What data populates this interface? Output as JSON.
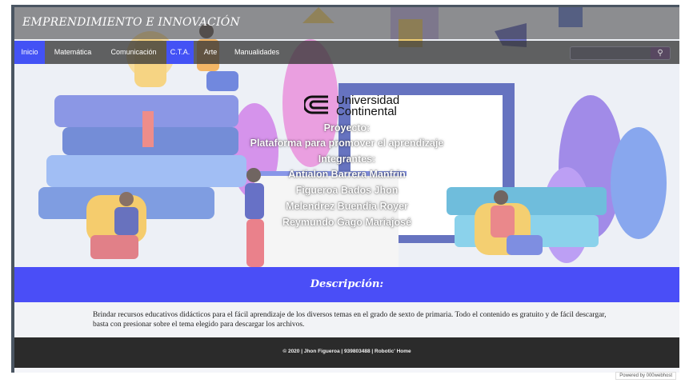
{
  "site": {
    "title": "EMPRENDIMIENTO E INNOVACIÓN"
  },
  "nav": {
    "items": [
      {
        "label": "Inicio",
        "active": true
      },
      {
        "label": "Matemática",
        "active": false
      },
      {
        "label": "Comunicación",
        "active": false
      },
      {
        "label": "C.T.A.",
        "active": true
      },
      {
        "label": "Arte",
        "active": false
      },
      {
        "label": "Manualidades",
        "active": false
      }
    ],
    "search_icon": "search-icon"
  },
  "hero": {
    "logo_line1": "Universidad",
    "logo_line2": "Continental",
    "project_label": "Proyecto:",
    "project_name": "Plataforma para promover el aprendizaje",
    "members_label": "Integrantes:",
    "members": [
      "Antialon Barrera Manfrin",
      "Figueroa Bados Jhon",
      "Melendrez Buendia Royer",
      "Reymundo Gago Mariajosé"
    ]
  },
  "description": {
    "title": "Descripción:",
    "text": "Brindar recursos educativos didácticos para el fácil aprendizaje de los diversos temas en el grado de sexto de primaria. Todo el contenido es gratuito y de fácil descargar, basta con presionar sobre el tema elegido para descargar los archivos."
  },
  "footer": {
    "text": "© 2020 | Jhon Figueroa | 939803488 | Robotic' Home",
    "powered": "Powered by 000webhost"
  },
  "colors": {
    "accent": "#4a4ef7",
    "nav_active": "#4352f5",
    "footer": "#2b2b2b"
  }
}
